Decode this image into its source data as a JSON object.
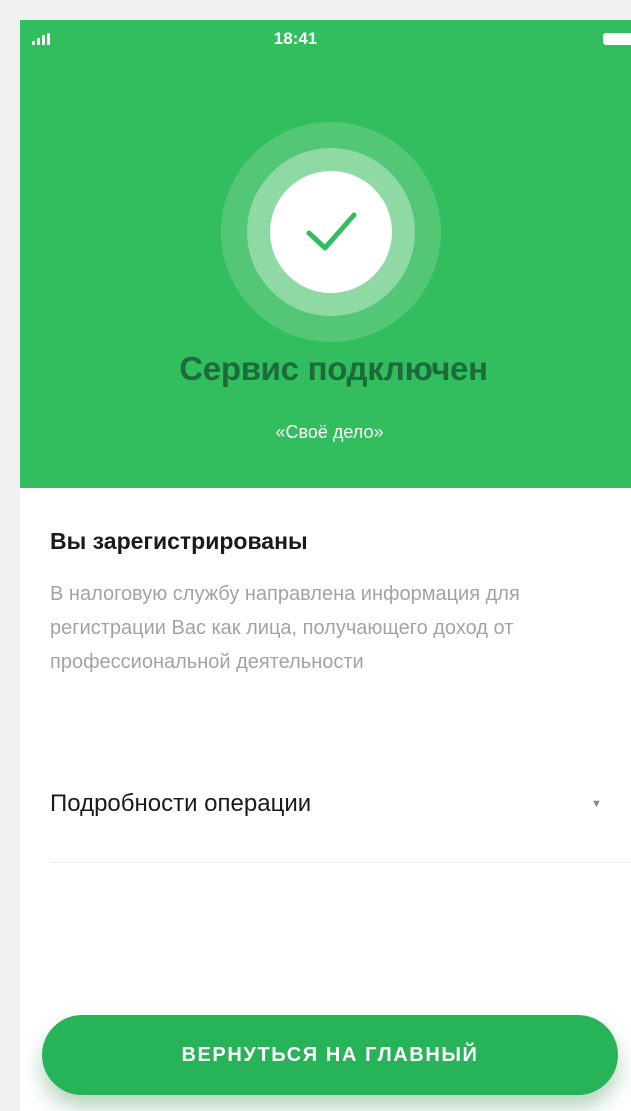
{
  "status_bar": {
    "time": "18:41",
    "signal_icon": "signal-icon",
    "battery_icon": "battery-icon"
  },
  "hero": {
    "icon": "check-icon",
    "title": "Сервис подключен",
    "subtitle": "«Своё дело»",
    "background_color": "#32bd5e"
  },
  "info": {
    "title": "Вы зарегистрированы",
    "body": "В налоговую службу направлена информация для регистрации Вас как лица, получающего доход от профессиональной деятельности"
  },
  "details": {
    "label": "Подробности операции",
    "caret_icon": "caret-down-icon",
    "caret_glyph": "▼"
  },
  "actions": {
    "home_button_label": "ВЕРНУТЬСЯ НА ГЛАВНЫЙ"
  }
}
